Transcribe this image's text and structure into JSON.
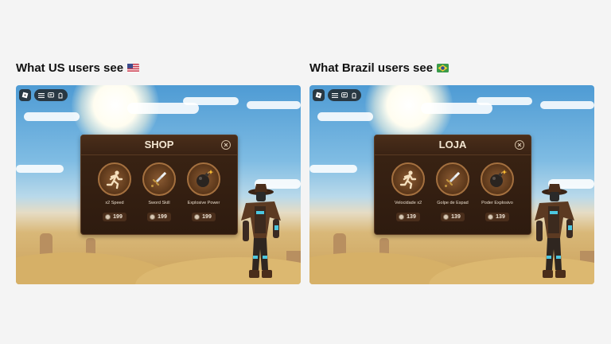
{
  "panels": [
    {
      "heading": "What US users see",
      "flag": "us",
      "shop": {
        "title": "SHOP",
        "items": [
          {
            "name": "x2 Speed",
            "icon": "running-person-icon",
            "price": "199"
          },
          {
            "name": "Sword Skill",
            "icon": "sword-icon",
            "price": "199"
          },
          {
            "name": "Explosive Power",
            "icon": "bomb-icon",
            "price": "199"
          }
        ]
      }
    },
    {
      "heading": "What Brazil users see",
      "flag": "brazil",
      "shop": {
        "title": "LOJA",
        "items": [
          {
            "name": "Velocidade x2",
            "icon": "running-person-icon",
            "price": "139"
          },
          {
            "name": "Golpe de Espad",
            "icon": "sword-icon",
            "price": "139"
          },
          {
            "name": "Poder Explosivo",
            "icon": "bomb-icon",
            "price": "139"
          }
        ]
      }
    }
  ],
  "colors": {
    "shop_bg": "#2e1b0f",
    "shop_border": "#5a3a22",
    "item_ring": "#a4703f",
    "price_chip": "#4a2e1b"
  }
}
